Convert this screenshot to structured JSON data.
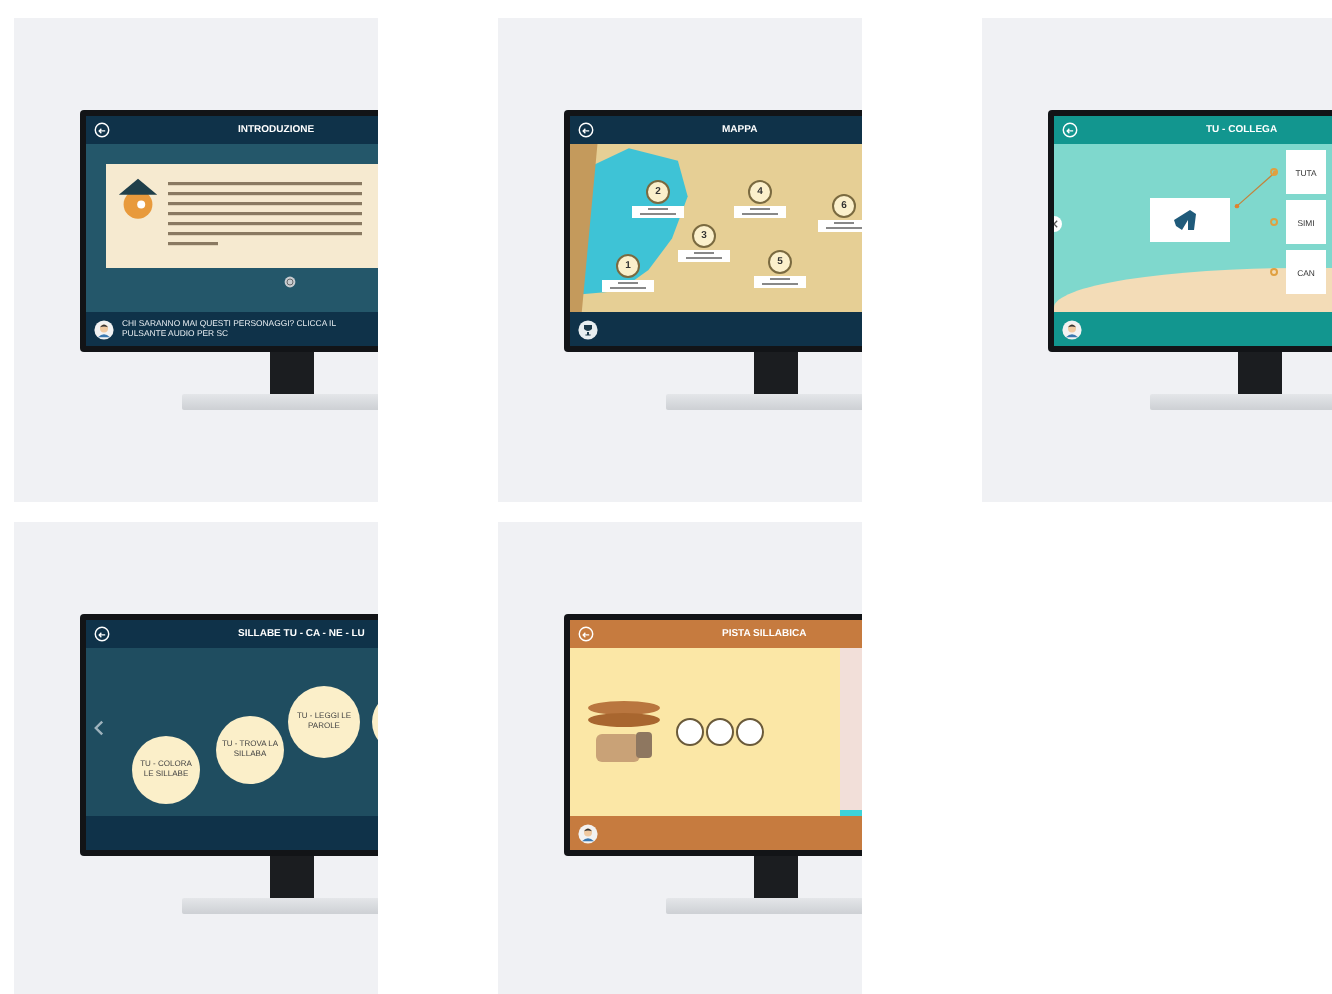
{
  "screens": [
    {
      "kind": "intro",
      "title": "INTRODUZIONE",
      "footer_text": "CHI SARANNO MAI QUESTI PERSONAGGI? CLICCA IL PULSANTE AUDIO PER SC"
    },
    {
      "kind": "map",
      "title": "MAPPA",
      "stops": [
        {
          "number": "1"
        },
        {
          "number": "2"
        },
        {
          "number": "3"
        },
        {
          "number": "4"
        },
        {
          "number": "5"
        },
        {
          "number": "6"
        }
      ]
    },
    {
      "kind": "match",
      "title": "TU - COLLEGA",
      "options": [
        "TUTA",
        "SIMI",
        "CAN"
      ]
    },
    {
      "kind": "syllables",
      "title": "SILLABE TU - CA - NE - LU",
      "bubbles": [
        "TU - COLORA LE SILLABE",
        "TU - TROVA LA SILLABA",
        "TU - LEGGI LE PAROLE"
      ]
    },
    {
      "kind": "track",
      "title": "PISTA SILLABICA"
    }
  ]
}
